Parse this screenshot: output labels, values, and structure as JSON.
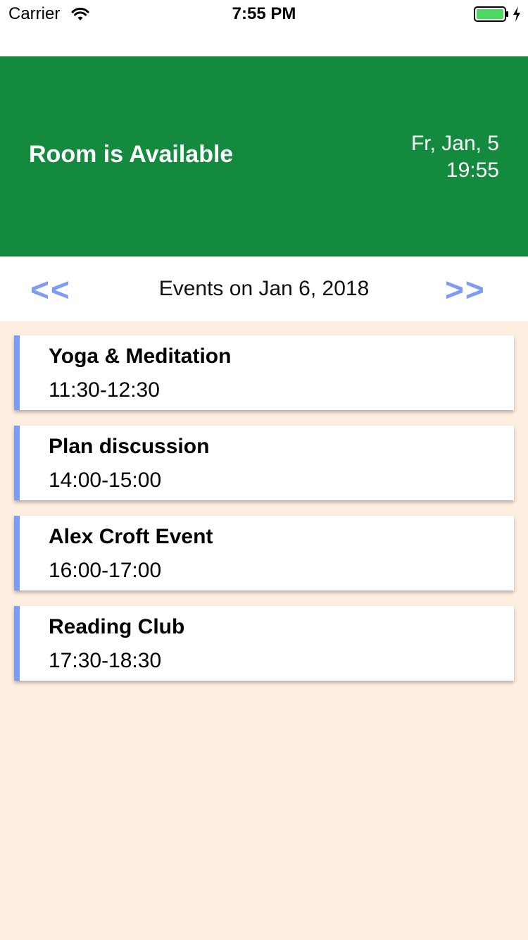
{
  "status_bar": {
    "carrier": "Carrier",
    "time": "7:55 PM",
    "battery_color": "#4cd964"
  },
  "banner": {
    "status": "Room is Available",
    "date": "Fr, Jan, 5",
    "time": "19:55",
    "color": "#138a3e"
  },
  "nav": {
    "prev_label": "<<",
    "next_label": ">>",
    "title": "Events on Jan 6, 2018",
    "accent": "#7f9cf5"
  },
  "events": [
    {
      "title": "Yoga & Meditation",
      "time": "11:30-12:30"
    },
    {
      "title": "Plan discussion",
      "time": "14:00-15:00"
    },
    {
      "title": "Alex Croft Event",
      "time": "16:00-17:00"
    },
    {
      "title": "Reading Club",
      "time": "17:30-18:30"
    }
  ],
  "icons": {
    "wifi": "wifi-icon",
    "battery": "battery-icon",
    "charging": "charging-bolt-icon"
  }
}
